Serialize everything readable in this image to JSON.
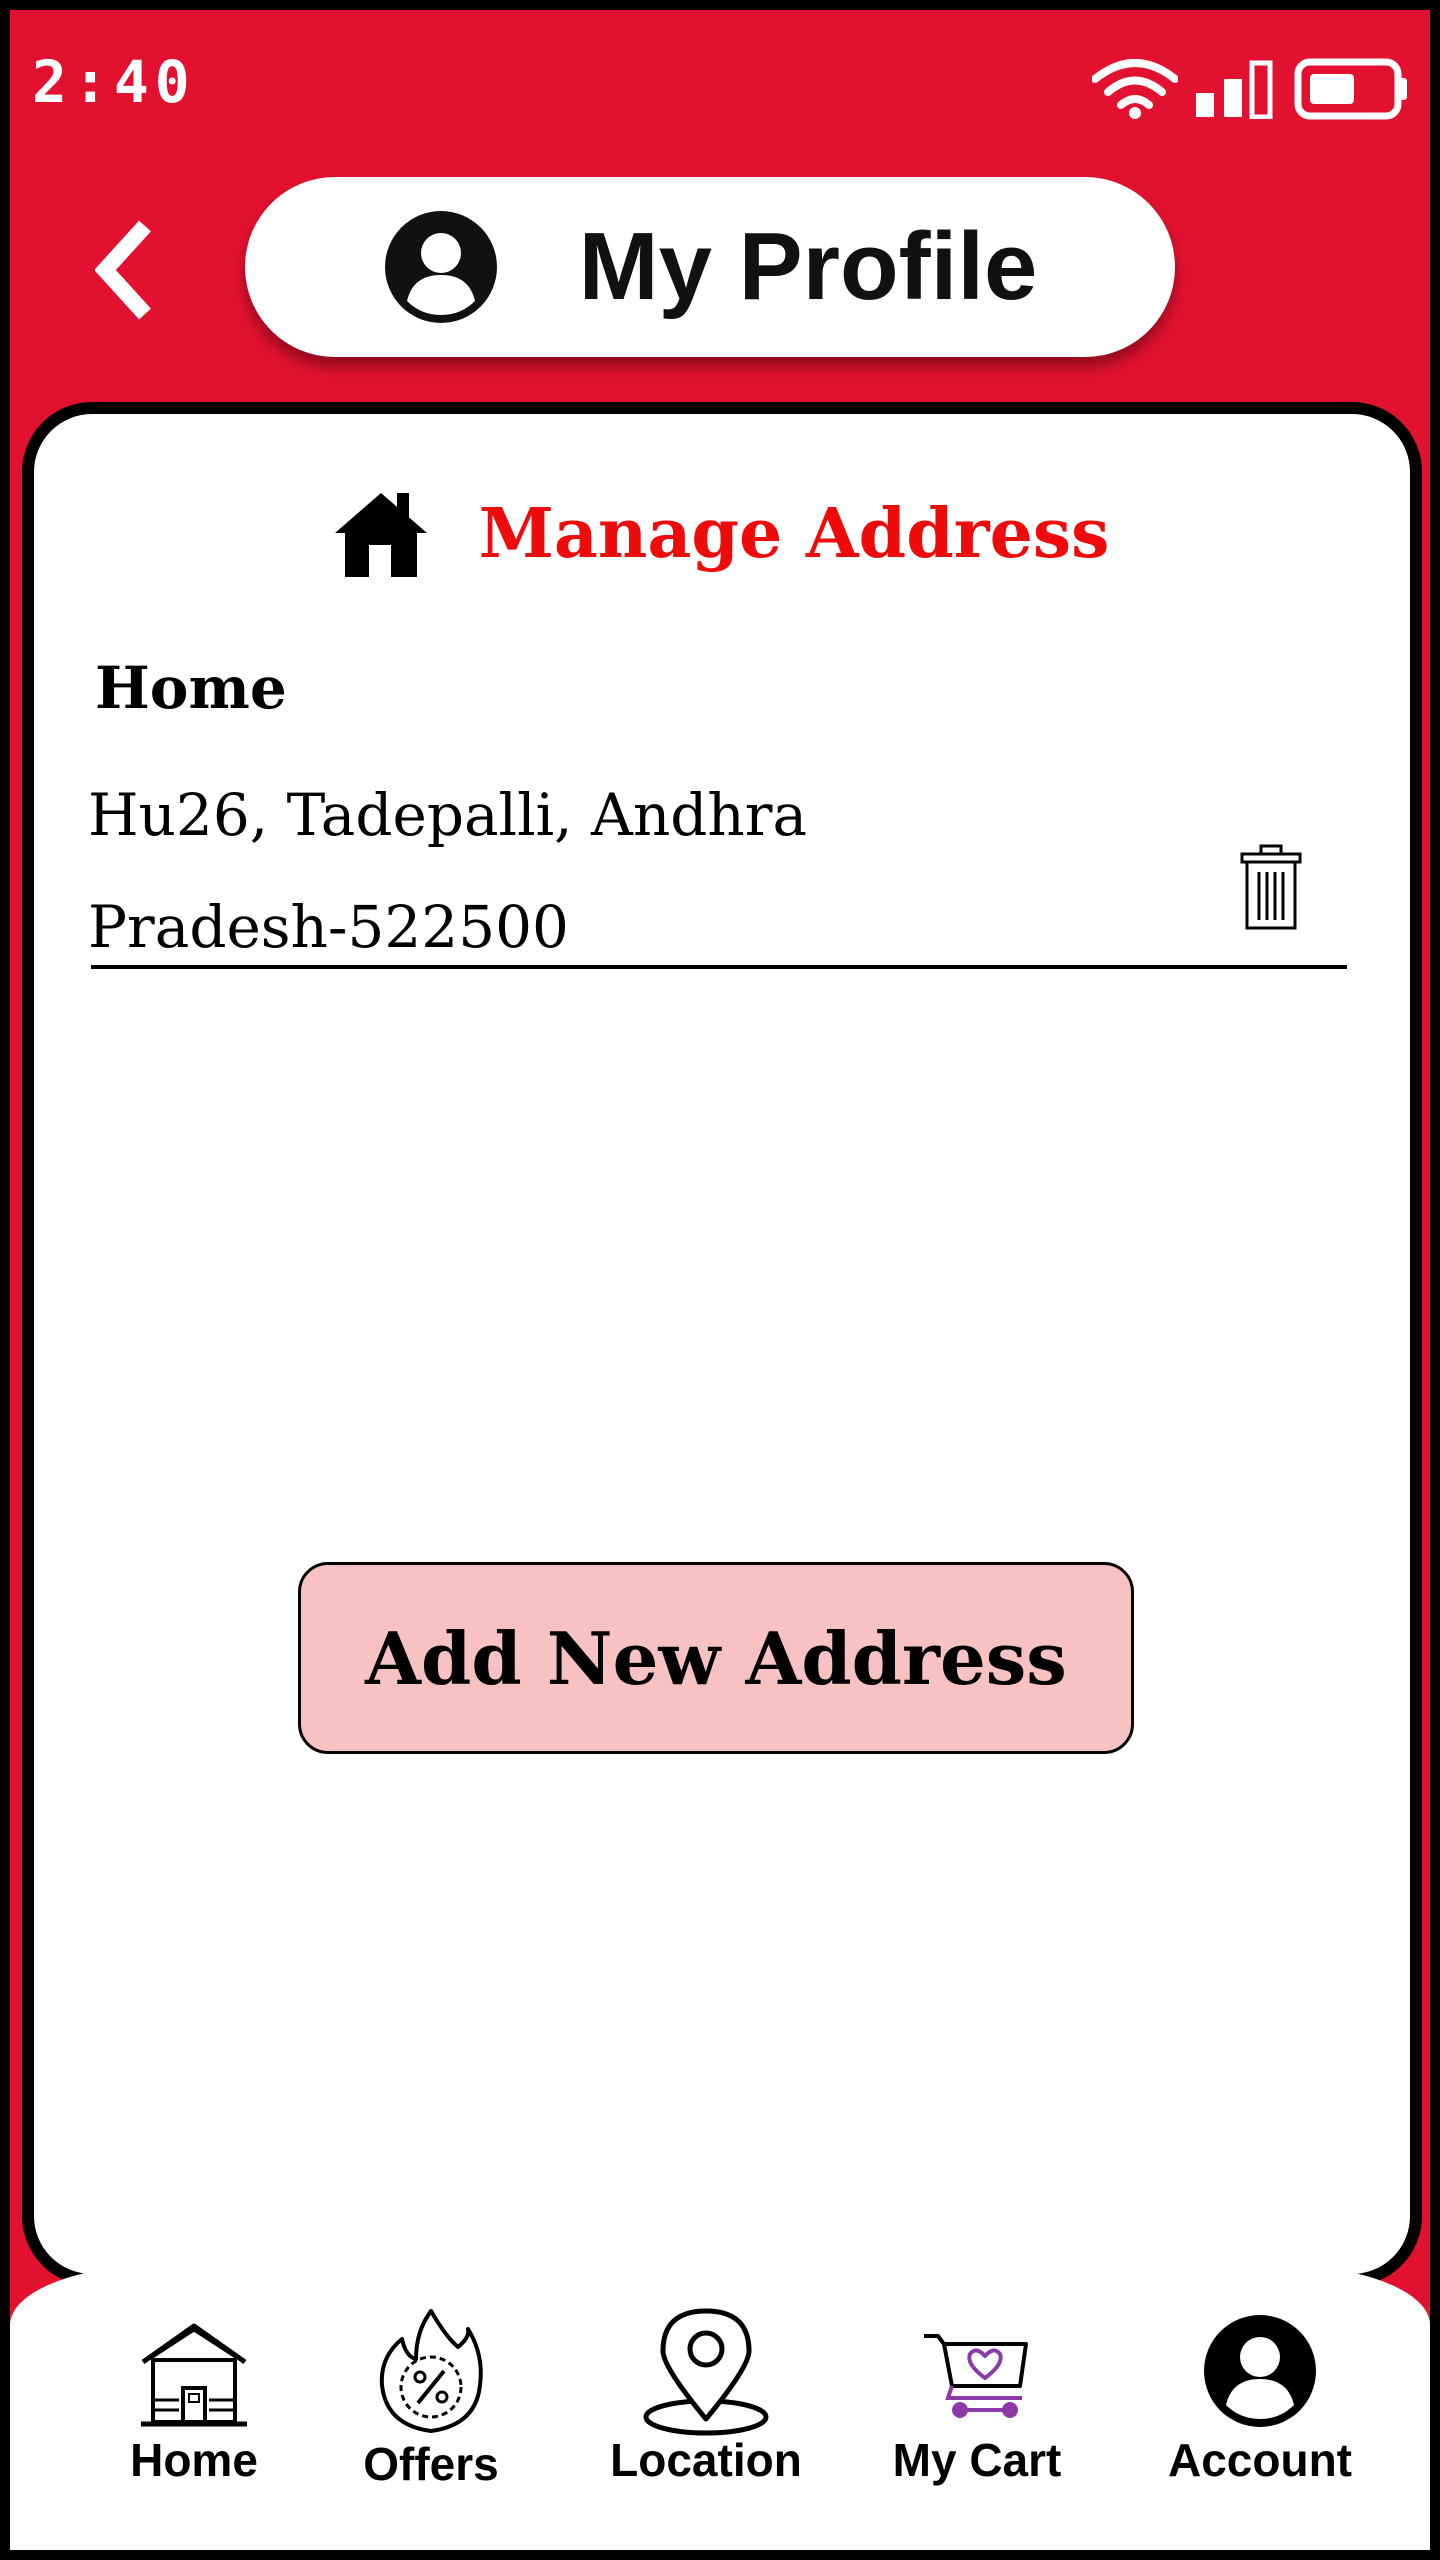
{
  "status_bar": {
    "time": "2:40"
  },
  "header": {
    "title": "My Profile"
  },
  "section": {
    "title": "Manage Address"
  },
  "address": {
    "label": "Home",
    "lines": [
      "Hu26, Tadepalli, Andhra",
      "Pradesh-522500"
    ]
  },
  "actions": {
    "add_label": "Add New Address"
  },
  "bottom_nav": {
    "items": [
      {
        "label": "Home",
        "icon": "house-icon"
      },
      {
        "label": "Offers",
        "icon": "offer-percent-icon"
      },
      {
        "label": "Location",
        "icon": "location-pin-icon"
      },
      {
        "label": "My Cart",
        "icon": "cart-heart-icon"
      },
      {
        "label": "Account",
        "icon": "account-icon"
      }
    ]
  },
  "colors": {
    "background": "#e31130",
    "section_title": "#ee0b0b",
    "button_fill": "#f8c2c3",
    "cart_accent": "#8b3aa8"
  }
}
